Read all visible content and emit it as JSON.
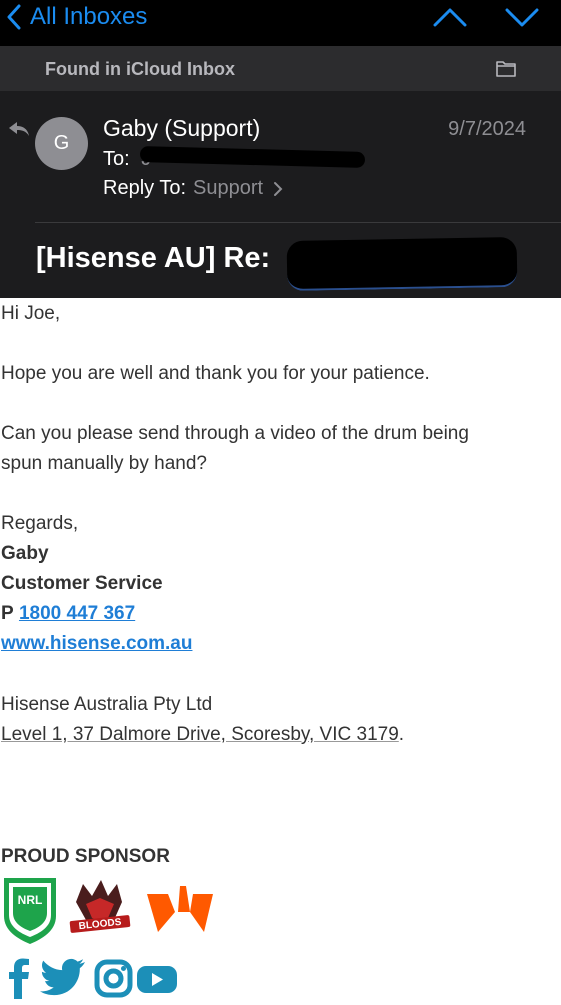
{
  "nav": {
    "back_label": "All Inboxes"
  },
  "banner": {
    "text": "Found in iCloud Inbox"
  },
  "header": {
    "avatar_initial": "G",
    "sender": "Gaby (Support)",
    "date": "9/7/2024",
    "to_label": "To:",
    "to_value": "J",
    "reply_to_label": "Reply To:",
    "reply_to_value": "Support",
    "subject": "[Hisense AU] Re:"
  },
  "body": {
    "greeting": "Hi Joe,",
    "p1": "Hope you are well and thank you for your patience.",
    "p2_line1": "Can you please send through a video of the drum being",
    "p2_line2": "spun manually by hand?",
    "regards": "Regards,",
    "sig_name": "Gaby",
    "sig_title": "Customer Service",
    "phone_prefix": "P",
    "phone": "1800 447 367",
    "website": "www.hisense.com.au",
    "company": "Hisense Australia Pty Ltd",
    "address": "Level 1, 37 Dalmore Drive, Scoresby, VIC 3179",
    "address_end": ".",
    "sponsor_heading": "PROUD SPONSOR"
  },
  "logos": {
    "nrl": "NRL",
    "bloods": "BLOODS"
  },
  "colors": {
    "accent": "#1b8cf0",
    "link": "#1f7ed6",
    "social": "#1c8fb8",
    "fnatic": "#ff5900",
    "nrl": "#1ea44b"
  }
}
